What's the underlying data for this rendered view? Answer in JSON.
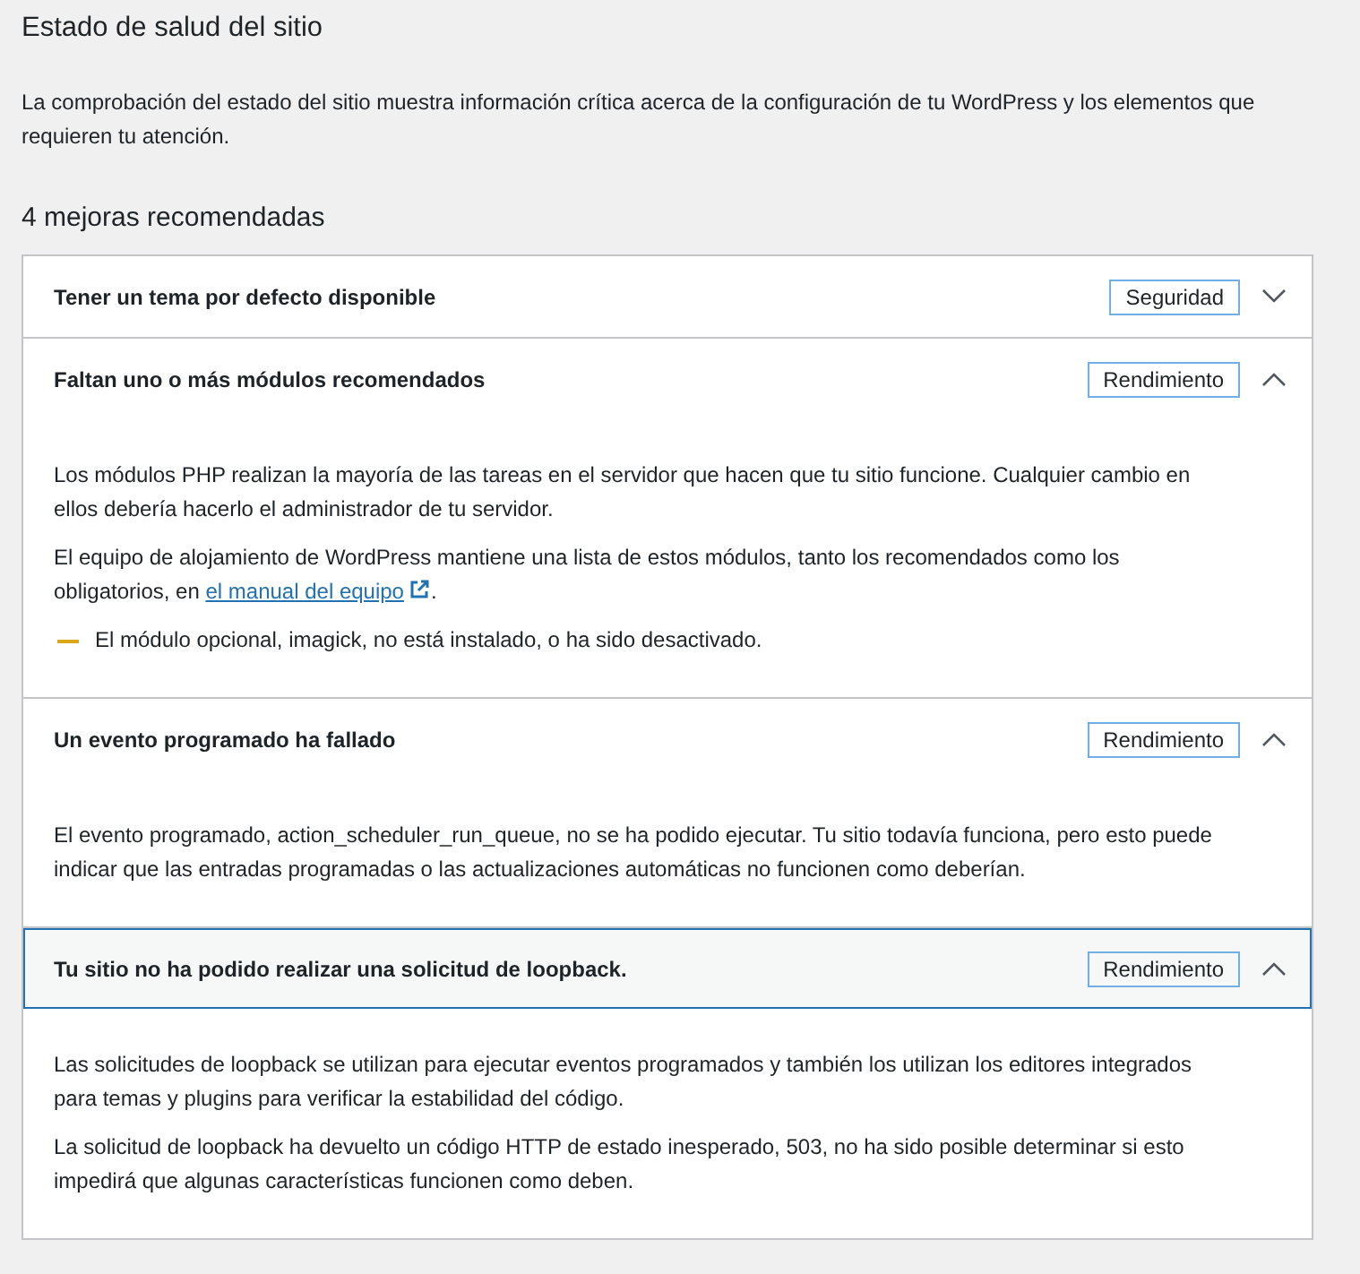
{
  "title": "Estado de salud del sitio",
  "description": "La comprobación del estado del sitio muestra información crítica acerca de la configuración de tu WordPress y los elementos que requieren tu atención.",
  "section_title": "4 mejoras recomendadas",
  "items": [
    {
      "title": "Tener un tema por defecto disponible",
      "badge": "Seguridad",
      "expanded": false,
      "focused": false
    },
    {
      "title": "Faltan uno o más módulos recomendados",
      "badge": "Rendimiento",
      "expanded": true,
      "focused": false,
      "paragraphs": [
        {
          "kind": "text",
          "text": "Los módulos PHP realizan la mayoría de las tareas en el servidor que hacen que tu sitio funcione. Cualquier cambio en ellos debería hacerlo el administrador de tu servidor."
        },
        {
          "kind": "link",
          "text": "El equipo de alojamiento de WordPress mantiene una lista de estos módulos, tanto los recomendados como los obligatorios, en ",
          "link": "el manual del equipo",
          "after": "."
        },
        {
          "kind": "warning",
          "text": "El módulo opcional, imagick, no está instalado, o ha sido desactivado."
        }
      ]
    },
    {
      "title": "Un evento programado ha fallado",
      "badge": "Rendimiento",
      "expanded": true,
      "focused": false,
      "paragraphs": [
        {
          "kind": "text",
          "text": "El evento programado, action_scheduler_run_queue, no se ha podido ejecutar. Tu sitio todavía funciona, pero esto puede indicar que las entradas programadas o las actualizaciones automáticas no funcionen como deberían."
        }
      ]
    },
    {
      "title": "Tu sitio no ha podido realizar una solicitud de loopback.",
      "badge": "Rendimiento",
      "expanded": true,
      "focused": true,
      "paragraphs": [
        {
          "kind": "text",
          "text": "Las solicitudes de loopback se utilizan para ejecutar eventos programados y también los utilizan los editores integrados para temas y plugins para verificar la estabilidad del código."
        },
        {
          "kind": "text",
          "text": "La solicitud de loopback ha devuelto un código HTTP de estado inesperado, 503, no ha sido posible determinar si esto impedirá que algunas características funcionen como deben."
        }
      ]
    }
  ]
}
